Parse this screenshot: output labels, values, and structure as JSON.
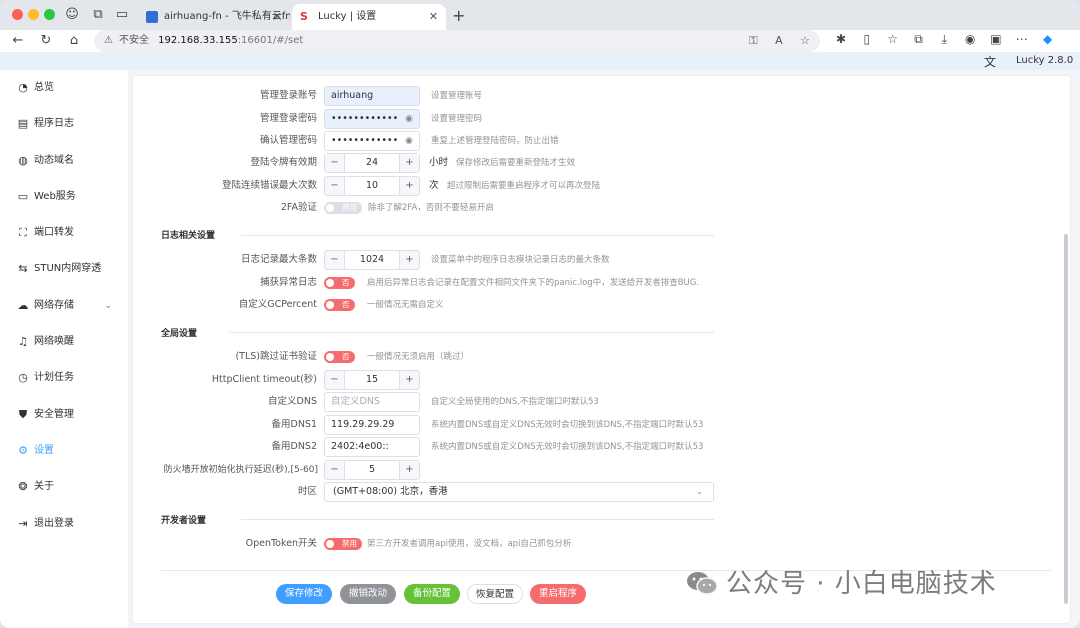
{
  "browser": {
    "tabs": [
      {
        "title": "airhuang-fn - 飞牛私有云fnOS"
      },
      {
        "title": "Lucky | 设置"
      }
    ],
    "address": {
      "security": "不安全",
      "host": "192.168.33.155",
      "rest": ":16601/#/set"
    }
  },
  "header": {
    "version": "Lucky 2.8.0"
  },
  "sidebar": {
    "items": [
      {
        "label": "总览"
      },
      {
        "label": "程序日志"
      },
      {
        "label": "动态域名"
      },
      {
        "label": "Web服务"
      },
      {
        "label": "端口转发"
      },
      {
        "label": "STUN内网穿透"
      },
      {
        "label": "网络存储"
      },
      {
        "label": "网络唤醒"
      },
      {
        "label": "计划任务"
      },
      {
        "label": "安全管理"
      },
      {
        "label": "设置"
      },
      {
        "label": "关于"
      },
      {
        "label": "退出登录"
      }
    ]
  },
  "form": {
    "account": {
      "label": "管理登录账号",
      "value": "airhuang",
      "hint": "设置管理账号"
    },
    "password": {
      "label": "管理登录密码",
      "value": "••••••••••••",
      "hint": "设置管理密码"
    },
    "password_confirm": {
      "label": "确认管理密码",
      "value": "••••••••••••",
      "hint": "重复上述管理登陆密码，防止出错"
    },
    "token_expiry": {
      "label": "登陆令牌有效期",
      "value": "24",
      "unit": "小时",
      "hint": "保存修改后需要重新登陆才生效"
    },
    "max_errors": {
      "label": "登陆连续错误最大次数",
      "value": "10",
      "unit": "次",
      "hint": "超过限制后需要重启程序才可以再次登陆"
    },
    "twofa": {
      "label": "2FA验证",
      "switch": "禁用",
      "hint": "除非了解2FA，否则不要轻易开启"
    }
  },
  "log_section": {
    "title": "日志相关设置",
    "max_logs": {
      "label": "日志记录最大条数",
      "value": "1024",
      "hint": "设置菜单中的程序日志模块记录日志的最大条数"
    },
    "panic_log": {
      "label": "捕获异常日志",
      "switch": "否",
      "hint": "启用后异常日志会记录在配置文件相同文件夹下的panic.log中，发送给开发者排查BUG."
    },
    "gc_percent": {
      "label": "自定义GCPercent",
      "switch": "否",
      "hint": "一般情况无需自定义"
    }
  },
  "global_section": {
    "title": "全局设置",
    "tls_skip": {
      "label": "(TLS)跳过证书验证",
      "switch": "否",
      "hint": "一般情况无须启用（跳过）"
    },
    "http_timeout": {
      "label": "HttpClient timeout(秒)",
      "value": "15"
    },
    "custom_dns": {
      "label": "自定义DNS",
      "placeholder": "自定义DNS",
      "hint": "自定义全局使用的DNS,不指定端口时默认53"
    },
    "dns1": {
      "label": "备用DNS1",
      "value": "119.29.29.29",
      "hint": "系统内置DNS或自定义DNS无效时会切换到该DNS,不指定端口时默认53"
    },
    "dns2": {
      "label": "备用DNS2",
      "value": "2402:4e00::",
      "hint": "系统内置DNS或自定义DNS无效时会切换到该DNS,不指定端口时默认53"
    },
    "firewall_delay": {
      "label": "防火墙开放初始化执行延迟(秒),[5-60]",
      "value": "5"
    },
    "timezone": {
      "label": "时区",
      "value": "(GMT+08:00) 北京，香港"
    }
  },
  "dev_section": {
    "title": "开发者设置",
    "opentoken": {
      "label": "OpenToken开关",
      "switch": "禁用",
      "hint": "第三方开发者调用api使用，没文档，api自己抓包分析"
    }
  },
  "actions": {
    "save": "保存修改",
    "undo": "撤销改动",
    "backup": "备份配置",
    "restore": "恢复配置",
    "restart": "重启程序"
  },
  "watermark": {
    "text": "公众号 · 小白电脑技术"
  },
  "colors": {
    "primary": "#409eff",
    "danger": "#f56c6c",
    "success": "#67c23a",
    "info": "#909399"
  }
}
